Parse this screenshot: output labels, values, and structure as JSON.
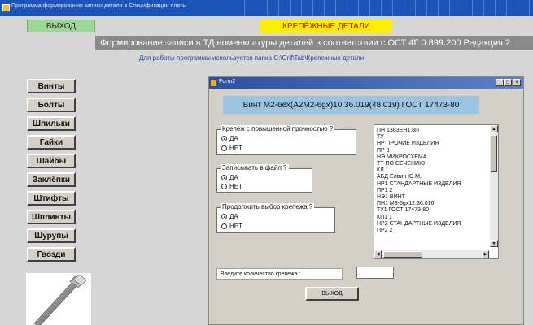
{
  "titlebar": {
    "title": "Программа формирования записи детали в Спецификации платы"
  },
  "top": {
    "exit_label": "ВЫХОД",
    "banner": "КРЕПЁЖНЫЕ ДЕТАЛИ",
    "format_line": "Формирование записи в ТД номенклатуры деталей в соответствии с ОСТ 4Г 0.899.200  Редакция 2",
    "folder_info": "Для работы программы используется папка  C:\\Grif\\Tab\\Крепежные детали"
  },
  "sidebar": {
    "items": [
      "Винты",
      "Болты",
      "Шпильки",
      "Гайки",
      "Шайбы",
      "Заклёпки",
      "Штифты",
      "Шплинты",
      "Шурупы",
      "Гвозди"
    ]
  },
  "form2": {
    "title": "Form2",
    "item_title": "Винт М2-6ех(А2М2-6gх)10.36.019(48.019) ГОСТ 17473-80",
    "groups": [
      {
        "title": "Крепёж с повышенной прочностью ?",
        "yes": "ДА",
        "no": "НЕТ",
        "selected": "ДА"
      },
      {
        "title": "Записывать в файл ?",
        "yes": "ДА",
        "no": "НЕТ",
        "selected": "ДА"
      },
      {
        "title": "Продолжить выбор крепежа ?",
        "yes": "ДА",
        "no": "НЕТ",
        "selected": "ДА"
      }
    ],
    "codes": [
      "ПН  1383ЕН1.8П",
      "ТУ",
      "НР  ПРОЧИЕ ИЗДЕЛИЯ",
      "ПР  3",
      "НЭ  МИКРОСХЕМА",
      "ТТ  ПО СЕЧЕНИЮ",
      "КЛ  1",
      "АБД Ёлвин Ю.М.",
      "НР1 СТАНДАРТНЫЕ ИЗДЕЛИЯ",
      "ПР1 2",
      "НЭ1 ВИНТ",
      "ПН1 М3-6gх12.36.016",
      "ТУ1 ГОСТ 17473-80",
      "КП1 1",
      "НР2 СТАНДАРТНЫЕ ИЗДЕЛИЯ",
      "ПР2 2"
    ],
    "qty_label": "Введите количество крепежа :",
    "qty_value": "",
    "exit_label": "ВЫХОД"
  }
}
